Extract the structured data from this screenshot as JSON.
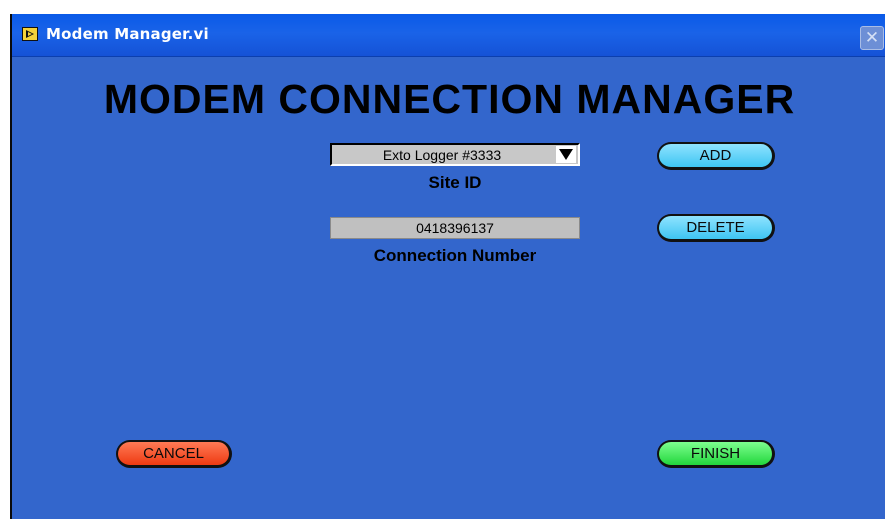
{
  "window": {
    "title": "Modem Manager.vi",
    "close_symbol": "✕"
  },
  "panel": {
    "heading": "MODEM CONNECTION MANAGER"
  },
  "site": {
    "selected": "Exto Logger #3333",
    "label": "Site ID"
  },
  "connection": {
    "value": "0418396137",
    "label": "Connection Number"
  },
  "buttons": {
    "add": "ADD",
    "delete": "DELETE",
    "cancel": "CANCEL",
    "finish": "FINISH"
  },
  "icons": {
    "app": "labview-vi-icon",
    "dropdown": "triangle-down-icon",
    "close": "close-icon"
  },
  "colors": {
    "panel_background": "#3366cc",
    "titlebar": "#0a5ae8",
    "add_delete_button": "#3ec5f2",
    "cancel_button": "#ee3a12",
    "finish_button": "#22d63c"
  }
}
